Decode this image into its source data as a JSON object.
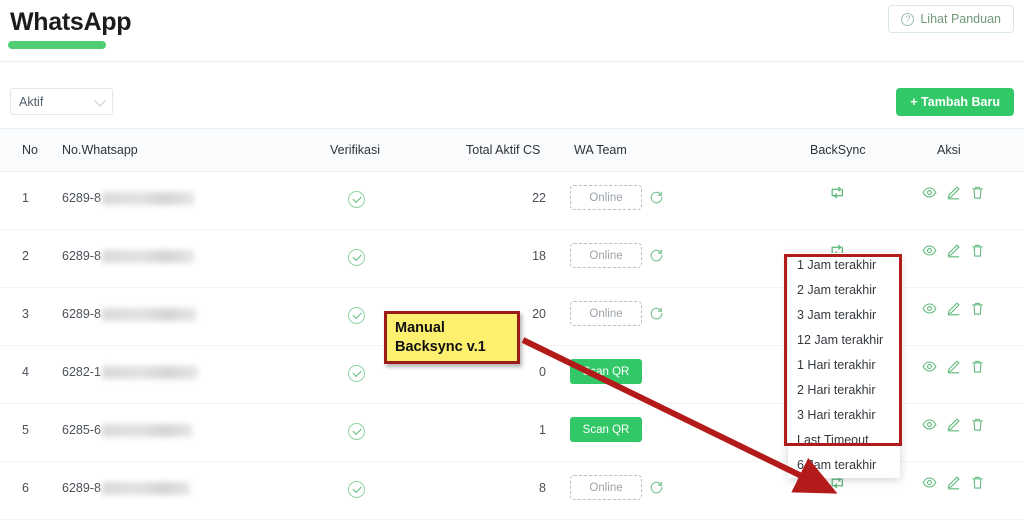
{
  "header": {
    "title": "WhatsApp",
    "guide_button": "Lihat Panduan",
    "guide_icon": "question-circle-icon"
  },
  "toolbar": {
    "filter_value": "Aktif",
    "add_button": "+ Tambah Baru"
  },
  "table": {
    "columns": [
      "No",
      "No.Whatsapp",
      "Verifikasi",
      "Total Aktif CS",
      "WA Team",
      "BackSync",
      "Aksi"
    ],
    "rows": [
      {
        "no": "1",
        "phone": "6289-8",
        "phone_redacted": true,
        "verified": true,
        "total_aktif_cs": "22",
        "wa_team": "Online",
        "wa_team_type": "online",
        "backsync": "sync-icon",
        "aksi": [
          "eye-icon",
          "pencil-icon",
          "trash-icon"
        ]
      },
      {
        "no": "2",
        "phone": "6289-8",
        "phone_redacted": true,
        "verified": true,
        "total_aktif_cs": "18",
        "wa_team": "Online",
        "wa_team_type": "online",
        "backsync": "sync-icon",
        "aksi": [
          "eye-icon",
          "pencil-icon",
          "trash-icon"
        ]
      },
      {
        "no": "3",
        "phone": "6289-8",
        "phone_redacted": true,
        "verified": true,
        "total_aktif_cs": "20",
        "wa_team": "Online",
        "wa_team_type": "online",
        "backsync": "sync-icon",
        "aksi": [
          "eye-icon",
          "pencil-icon",
          "trash-icon"
        ]
      },
      {
        "no": "4",
        "phone": "6282-1",
        "phone_redacted": true,
        "verified": true,
        "total_aktif_cs": "0",
        "wa_team": "Scan QR",
        "wa_team_type": "scanqr",
        "backsync": "sync-icon",
        "aksi": [
          "eye-icon",
          "pencil-icon",
          "trash-icon"
        ]
      },
      {
        "no": "5",
        "phone": "6285-6",
        "phone_redacted": true,
        "verified": true,
        "total_aktif_cs": "1",
        "wa_team": "Scan QR",
        "wa_team_type": "scanqr",
        "backsync": "sync-icon",
        "aksi": [
          "eye-icon",
          "pencil-icon",
          "trash-icon"
        ]
      },
      {
        "no": "6",
        "phone": "6289-8",
        "phone_redacted": true,
        "verified": true,
        "total_aktif_cs": "8",
        "wa_team": "Online",
        "wa_team_type": "online",
        "backsync": "sync-icon",
        "aksi": [
          "eye-icon",
          "pencil-icon",
          "trash-icon"
        ]
      }
    ]
  },
  "backsync_dropdown": {
    "items": [
      "1 Jam terakhir",
      "2 Jam terakhir",
      "3 Jam terakhir",
      "12 Jam terakhir",
      "1 Hari terakhir",
      "2 Hari terakhir",
      "3 Hari terakhir",
      "Last Timeout",
      "6 Jam terakhir"
    ]
  },
  "annotation": {
    "label_line1": "Manual",
    "label_line2": "Backsync v.1",
    "box_color": "#fdf06f",
    "border_color": "#9c1c1c",
    "arrow_color": "#b31b1b",
    "highlight_color": "#b31b1b"
  },
  "colors": {
    "brand_green": "#32c767",
    "tab_green": "#4fce72",
    "icon_green": "#5ab878",
    "text": "#2e3338"
  }
}
